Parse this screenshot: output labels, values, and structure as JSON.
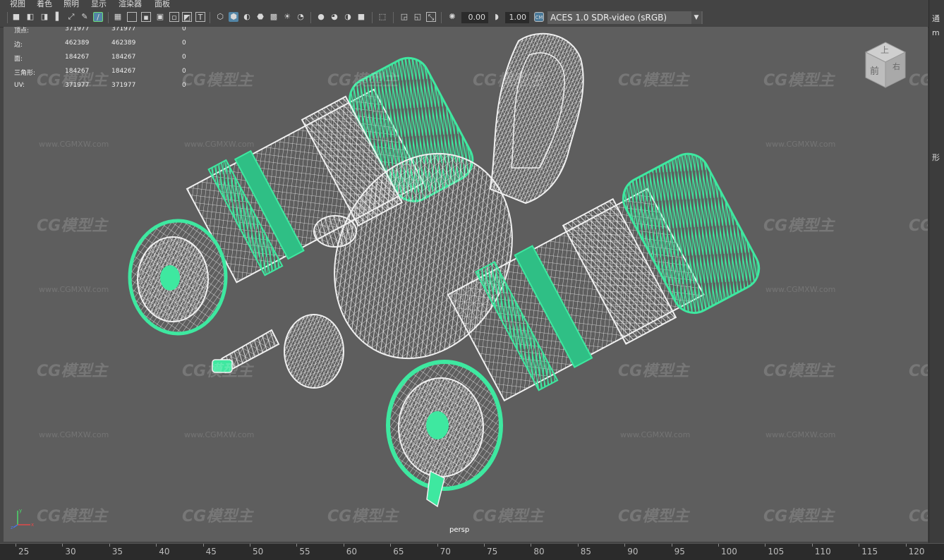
{
  "menu": [
    "视图",
    "着色",
    "照明",
    "显示",
    "渲染器",
    "面板"
  ],
  "toolbar": {
    "exposure": "0.00",
    "gamma": "1.00",
    "color_space": "ACES 1.0 SDR-video (sRGB)"
  },
  "hud": {
    "rows": [
      {
        "label": "顶点:",
        "a": "371977",
        "b": "371977",
        "c": "0"
      },
      {
        "label": "边:",
        "a": "462389",
        "b": "462389",
        "c": "0"
      },
      {
        "label": "面:",
        "a": "184267",
        "b": "184267",
        "c": "0"
      },
      {
        "label": "三角形:",
        "a": "184267",
        "b": "184267",
        "c": "0"
      },
      {
        "label": "UV:",
        "a": "371977",
        "b": "371977",
        "c": "0"
      }
    ]
  },
  "viewcube": {
    "top": "上",
    "front": "前",
    "right": "右"
  },
  "camera_label": "persp",
  "watermark": {
    "logo": "CG模型主",
    "url": "www.CGMXW.com"
  },
  "right_panel": {
    "items": [
      "通",
      "m",
      "形"
    ]
  },
  "timeline": {
    "ticks": [
      "25",
      "30",
      "35",
      "40",
      "45",
      "50",
      "55",
      "60",
      "65",
      "70",
      "75",
      "80",
      "85",
      "90",
      "95",
      "100",
      "105",
      "110",
      "115",
      "120"
    ]
  },
  "colors": {
    "viewport_bg": "#5e5e5e",
    "wire_white": "#f0f0f0",
    "wire_green": "#3ee8a0"
  }
}
